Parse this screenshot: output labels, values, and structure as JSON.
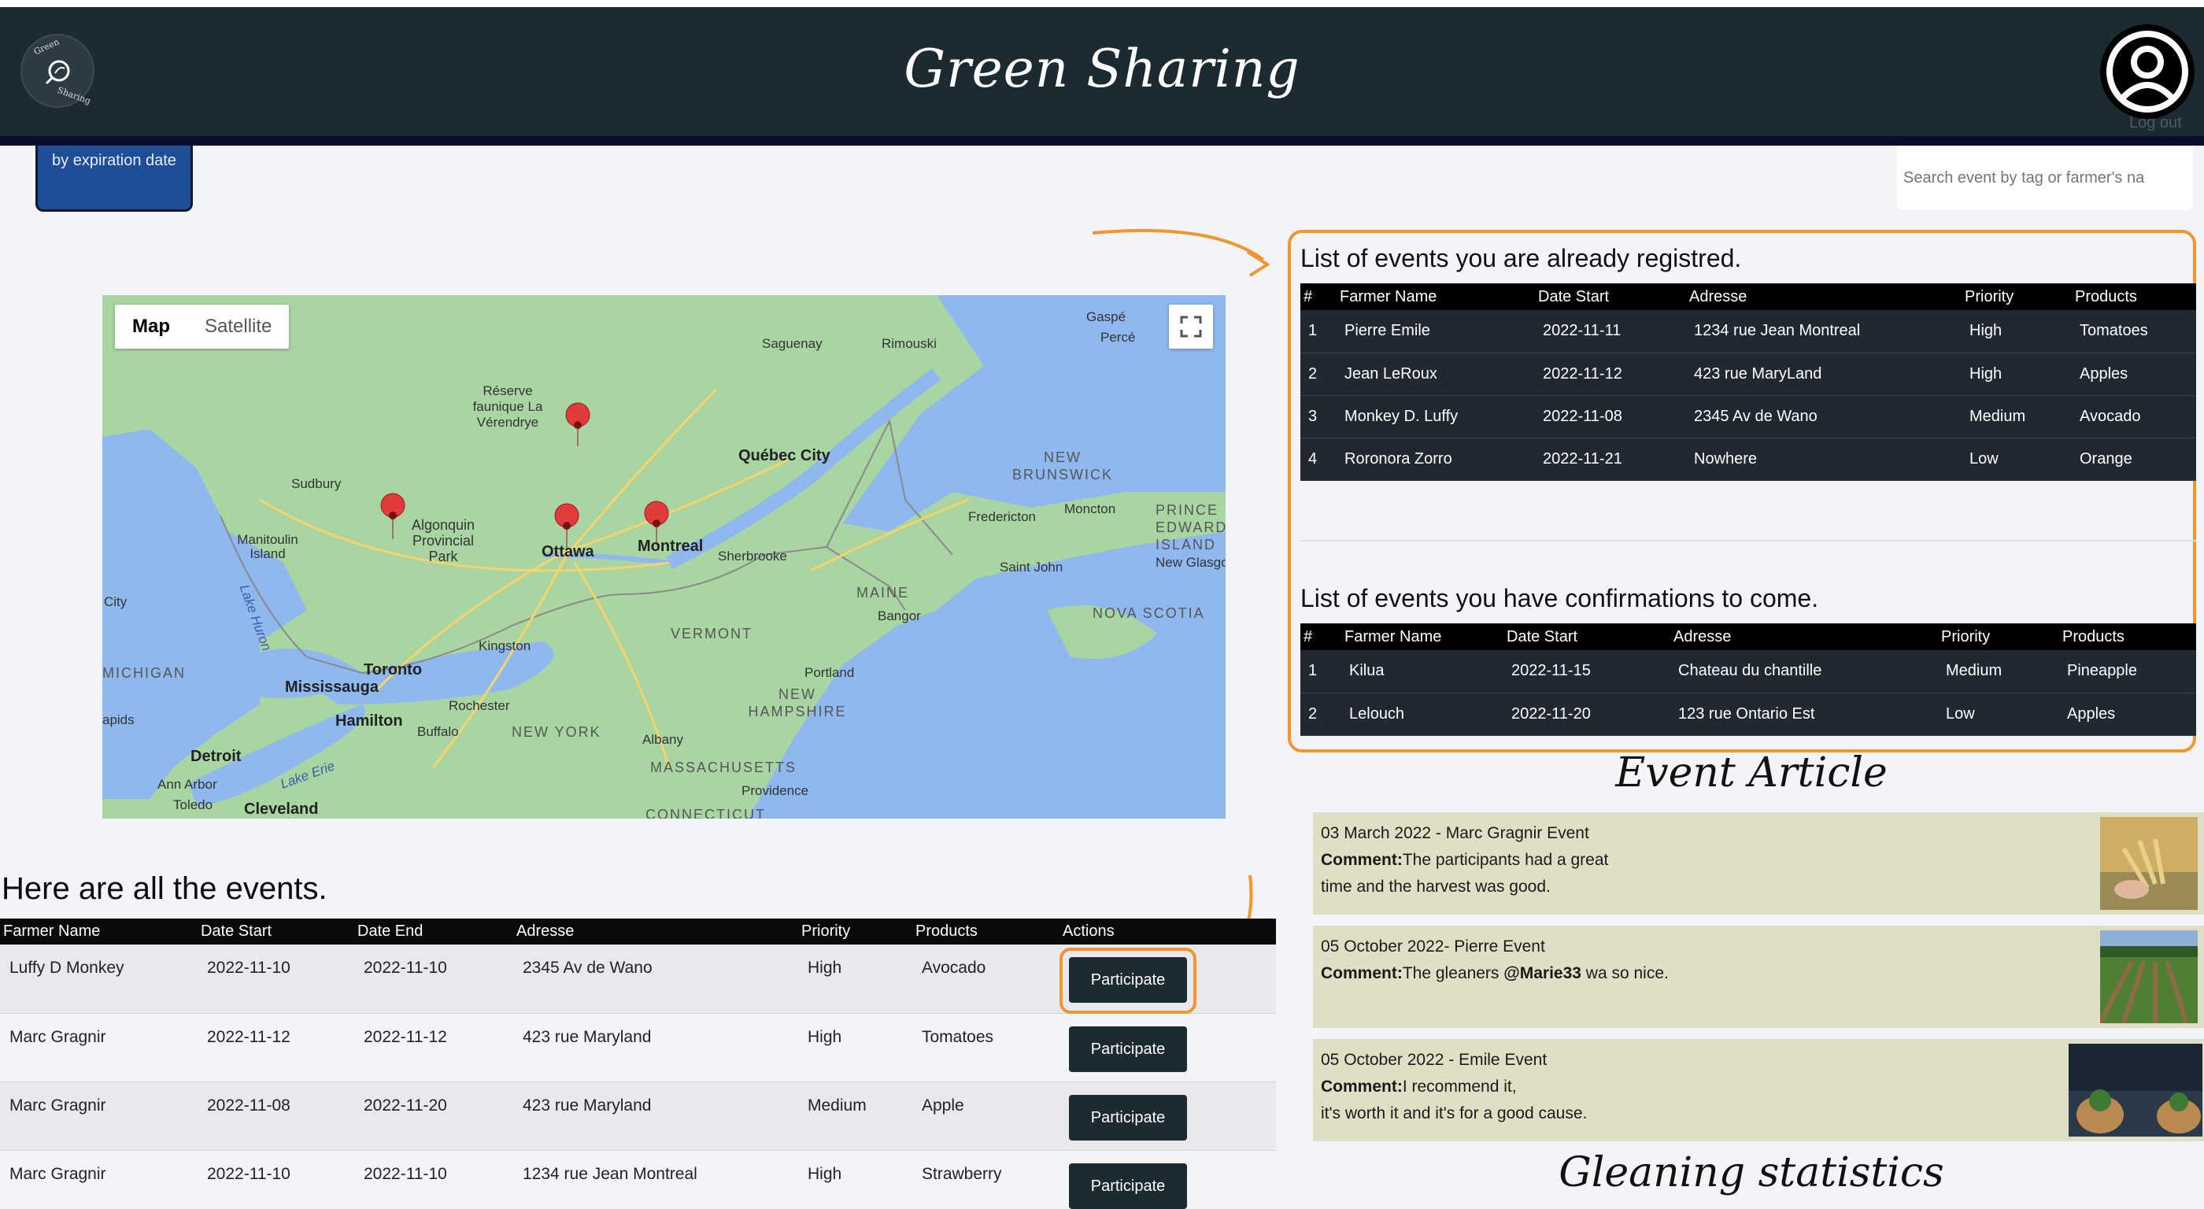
{
  "header": {
    "title": "Green Sharing",
    "logo_text_top": "Green",
    "logo_text_bottom": "Sharing",
    "logout_label": "Log out"
  },
  "sort_button": {
    "label": "by expiration date"
  },
  "search": {
    "placeholder": "Search event by tag or farmer's na"
  },
  "map": {
    "toggle_map": "Map",
    "toggle_satellite": "Satellite",
    "labels": {
      "gaspe": "Gaspé",
      "perce": "Percé",
      "saguenay": "Saguenay",
      "rimouski": "Rimouski",
      "reserve": "Réserve faunique La Vérendrye",
      "sudbury": "Sudbury",
      "quebec": "Québec City",
      "new_brunswick": "NEW BRUNSWICK",
      "manitoulin": "Manitoulin Island",
      "algonquin": "Algonquin Provincial Park",
      "ottawa": "Ottawa",
      "montreal": "Montreal",
      "fredericton": "Fredericton",
      "moncton": "Moncton",
      "pei": "PRINCE EDWARD ISLAND",
      "sherbrooke": "Sherbrooke",
      "saint_john": "Saint John",
      "new_glasgow": "New Glasgow",
      "lake_huron": "Lake Huron",
      "city": "City",
      "maine": "MAINE",
      "bangor": "Bangor",
      "nova_scotia": "NOVA SCOTIA",
      "kingston": "Kingston",
      "vermont": "VERMONT",
      "michigan": "MICHIGAN",
      "toronto": "Toronto",
      "mississauga": "Mississauga",
      "portland": "Portland",
      "rochester": "Rochester",
      "new_hampshire": "NEW HAMPSHIRE",
      "hamilton": "Hamilton",
      "buffalo": "Buffalo",
      "new_york": "NEW YORK",
      "albany": "Albany",
      "apids": "apids",
      "detroit": "Detroit",
      "massachusetts": "MASSACHUSETTS",
      "ann_arbor": "Ann Arbor",
      "lake_erie": "Lake Erie",
      "toledo": "Toledo",
      "cleveland": "Cleveland",
      "providence": "Providence",
      "connecticut": "CONNECTICUT"
    }
  },
  "events": {
    "heading": "Here are all the events.",
    "columns": [
      "Farmer Name",
      "Date Start",
      "Date End",
      "Adresse",
      "Priority",
      "Products",
      "Actions"
    ],
    "action_label": "Participate",
    "rows": [
      {
        "farmer": "Luffy D Monkey",
        "start": "2022-11-10",
        "end": "2022-11-10",
        "address": "2345 Av de Wano",
        "priority": "High",
        "product": "Avocado"
      },
      {
        "farmer": "Marc Gragnir",
        "start": "2022-11-12",
        "end": "2022-11-12",
        "address": "423 rue Maryland",
        "priority": "High",
        "product": "Tomatoes"
      },
      {
        "farmer": "Marc Gragnir",
        "start": "2022-11-08",
        "end": "2022-11-20",
        "address": "423 rue Maryland",
        "priority": "Medium",
        "product": "Apple"
      },
      {
        "farmer": "Marc Gragnir",
        "start": "2022-11-10",
        "end": "2022-11-10",
        "address": "1234 rue Jean Montreal",
        "priority": "High",
        "product": "Strawberry"
      }
    ]
  },
  "registered": {
    "heading": "List of events you are already registred.",
    "columns": [
      "#",
      "Farmer Name",
      "Date Start",
      "Adresse",
      "Priority",
      "Products"
    ],
    "rows": [
      {
        "n": "1",
        "farmer": "Pierre Emile",
        "start": "2022-11-11",
        "address": "1234 rue Jean Montreal",
        "priority": "High",
        "product": "Tomatoes"
      },
      {
        "n": "2",
        "farmer": "Jean LeRoux",
        "start": "2022-11-12",
        "address": "423 rue MaryLand",
        "priority": "High",
        "product": "Apples"
      },
      {
        "n": "3",
        "farmer": "Monkey D. Luffy",
        "start": "2022-11-08",
        "address": "2345 Av de Wano",
        "priority": "Medium",
        "product": "Avocado"
      },
      {
        "n": "4",
        "farmer": "Roronora Zorro",
        "start": "2022-11-21",
        "address": "Nowhere",
        "priority": "Low",
        "product": "Orange"
      }
    ]
  },
  "confirmations": {
    "heading": "List of events you have confirmations to come.",
    "columns": [
      "#",
      "Farmer Name",
      "Date Start",
      "Adresse",
      "Priority",
      "Products"
    ],
    "rows": [
      {
        "n": "1",
        "farmer": "Kilua",
        "start": "2022-11-15",
        "address": "Chateau du chantille",
        "priority": "Medium",
        "product": "Pineapple"
      },
      {
        "n": "2",
        "farmer": "Lelouch",
        "start": "2022-11-20",
        "address": "123 rue Ontario Est",
        "priority": "Low",
        "product": "Apples"
      }
    ]
  },
  "articles": {
    "heading": "Event Article",
    "items": [
      {
        "title": "03 March 2022 - Marc Gragnir Event",
        "comment_label": "Comment:",
        "line1": "The participants had a great",
        "line2": "time and the harvest was good.",
        "mention": ""
      },
      {
        "title": "05 October 2022- Pierre Event",
        "comment_label": "Comment:",
        "line1": "The gleaners ",
        "mention": "@Marie33",
        "line1b": " wa so nice.",
        "line2": ""
      },
      {
        "title": "05 October 2022 - Emile Event",
        "comment_label": "Comment:",
        "line1": "I recommend it,",
        "line2": "it's worth it and it's for a good cause.",
        "mention": ""
      }
    ]
  },
  "stats": {
    "heading": "Gleaning statistics"
  },
  "colors": {
    "header_bg": "#1c2a32",
    "accent_orange": "#f0962e",
    "sort_blue": "#1d4e97",
    "article_bg": "#dedfc4"
  }
}
